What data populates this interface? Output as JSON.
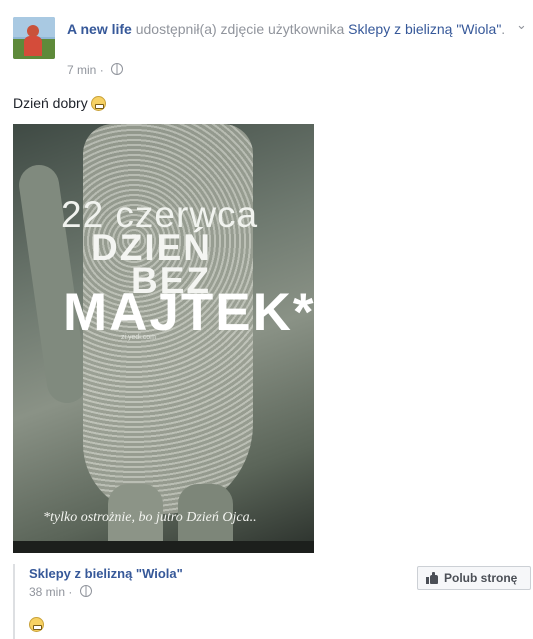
{
  "post": {
    "author": "A new life",
    "action_text": "udostępnił(a) zdjęcie użytkownika",
    "page_name": "Sklepy z bielizną \"Wiola\"",
    "trailing": ".",
    "time": "7 min",
    "time_separator": "·",
    "message": "Dzień dobry"
  },
  "image_text": {
    "line1": "22 czerwca",
    "line2": "DZIEŃ",
    "line3": "BEZ",
    "line4": "MAJTEK*",
    "watermark": "zi.yedi.com",
    "footnote": "*tylko ostrożnie, bo jutro Dzień Ojca.."
  },
  "shared": {
    "page_name": "Sklepy z bielizną \"Wiola\"",
    "time": "38 min",
    "time_separator": "·",
    "like_button": "Polub stronę"
  },
  "icons": {
    "menu": "chevron-down-icon",
    "privacy": "globe-icon",
    "emoji": "smiley-emoji-icon",
    "like": "thumbs-up-icon"
  }
}
